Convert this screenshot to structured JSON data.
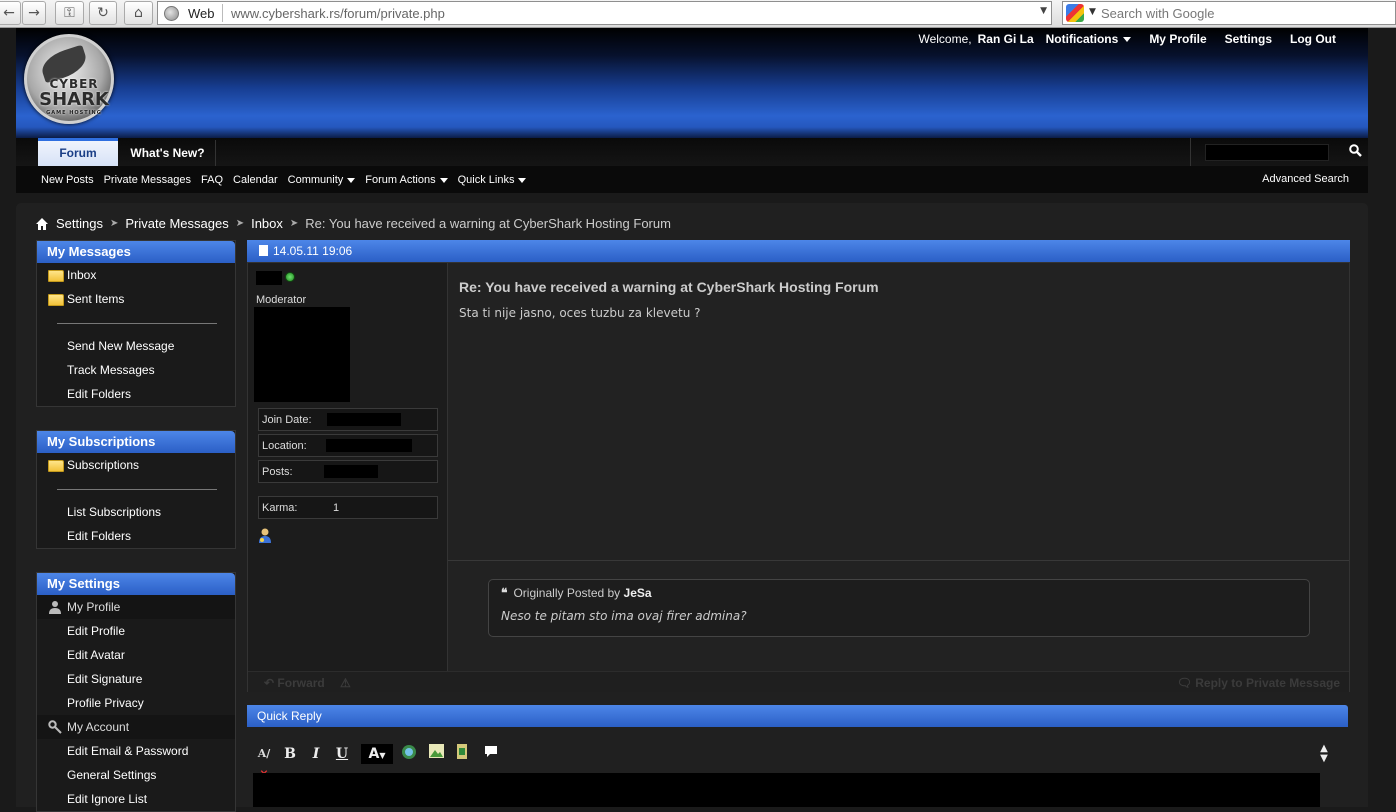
{
  "browser": {
    "back_icon": "back-arrow-icon",
    "forward_icon": "forward-arrow-icon",
    "web_label": "Web",
    "url": "www.cybershark.rs/forum/private.php",
    "search_placeholder": "Search with Google"
  },
  "header": {
    "logo_text_1": "CYBER",
    "logo_text_2": "SHARK",
    "logo_text_3": "GAME HOSTING",
    "welcome": "Welcome,",
    "username": "Ran Gi La",
    "notifications": "Notifications",
    "my_profile": "My Profile",
    "settings": "Settings",
    "logout": "Log Out"
  },
  "nav": {
    "tab_forum": "Forum",
    "tab_whats_new": "What's New?",
    "sub_items": [
      "New Posts",
      "Private Messages",
      "FAQ",
      "Calendar",
      "Community",
      "Forum Actions",
      "Quick Links"
    ],
    "advanced_search": "Advanced Search"
  },
  "breadcrumb": {
    "items": [
      "Settings",
      "Private Messages",
      "Inbox"
    ],
    "current": "Re: You have received a warning at CyberShark Hosting Forum"
  },
  "sidebar": {
    "messages": {
      "title": "My Messages",
      "folders": [
        "Inbox",
        "Sent Items"
      ],
      "links": [
        "Send New Message",
        "Track Messages",
        "Edit Folders"
      ]
    },
    "subscriptions": {
      "title": "My Subscriptions",
      "folders": [
        "Subscriptions"
      ],
      "links": [
        "List Subscriptions",
        "Edit Folders"
      ]
    },
    "settings": {
      "title": "My Settings",
      "profile_header": "My Profile",
      "profile_links": [
        "Edit Profile",
        "Edit Avatar",
        "Edit Signature",
        "Profile Privacy"
      ],
      "account_header": "My Account",
      "account_links": [
        "Edit Email & Password",
        "General Settings",
        "Edit Ignore List"
      ]
    }
  },
  "message": {
    "date": "14.05.11 19:06",
    "user_title": "Moderator",
    "join_date_label": "Join Date:",
    "location_label": "Location:",
    "posts_label": "Posts:",
    "karma_label": "Karma:",
    "karma_value": "1",
    "title": "Re: You have received a warning at CyberShark Hosting Forum",
    "text": "Sta ti nije jasno, oces tuzbu za klevetu ?",
    "quote": {
      "prefix": "Originally Posted by",
      "author": "JeSa",
      "text": "Neso te pitam sto ima ovaj firer admina?"
    },
    "forward": "Forward",
    "reply": "Reply to Private Message"
  },
  "quick_reply": {
    "title": "Quick Reply",
    "toolbar": [
      "B",
      "I",
      "U",
      "A"
    ]
  },
  "colors": {
    "accent_blue": "#2f6fe0",
    "header_blue": "#2b63cf",
    "background": "#1a1a1a"
  }
}
